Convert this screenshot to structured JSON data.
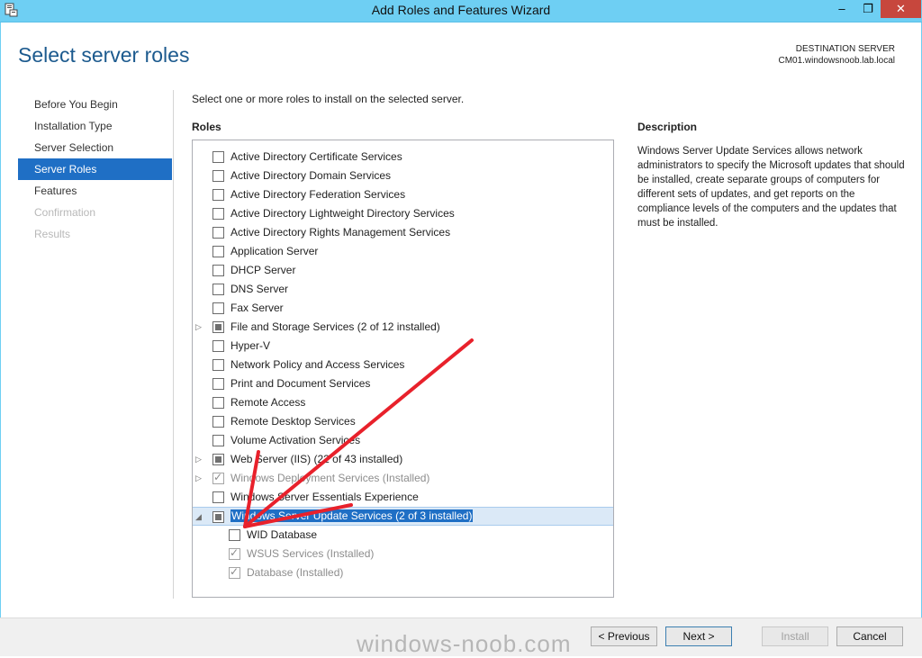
{
  "window": {
    "title": "Add Roles and Features Wizard",
    "min_label": "–",
    "max_label": "❐",
    "close_label": "✕"
  },
  "header": {
    "page_title": "Select server roles",
    "destination_label": "DESTINATION SERVER",
    "destination_value": "CM01.windowsnoob.lab.local"
  },
  "nav": {
    "items": [
      {
        "label": "Before You Begin",
        "state": "normal"
      },
      {
        "label": "Installation Type",
        "state": "normal"
      },
      {
        "label": "Server Selection",
        "state": "normal"
      },
      {
        "label": "Server Roles",
        "state": "active"
      },
      {
        "label": "Features",
        "state": "normal"
      },
      {
        "label": "Confirmation",
        "state": "disabled"
      },
      {
        "label": "Results",
        "state": "disabled"
      }
    ]
  },
  "main": {
    "instruction": "Select one or more roles to install on the selected server.",
    "roles_heading": "Roles",
    "roles": [
      {
        "label": "Active Directory Certificate Services",
        "state": "unchecked",
        "expander": "",
        "indent": 0
      },
      {
        "label": "Active Directory Domain Services",
        "state": "unchecked",
        "expander": "",
        "indent": 0
      },
      {
        "label": "Active Directory Federation Services",
        "state": "unchecked",
        "expander": "",
        "indent": 0
      },
      {
        "label": "Active Directory Lightweight Directory Services",
        "state": "unchecked",
        "expander": "",
        "indent": 0
      },
      {
        "label": "Active Directory Rights Management Services",
        "state": "unchecked",
        "expander": "",
        "indent": 0
      },
      {
        "label": "Application Server",
        "state": "unchecked",
        "expander": "",
        "indent": 0
      },
      {
        "label": "DHCP Server",
        "state": "unchecked",
        "expander": "",
        "indent": 0
      },
      {
        "label": "DNS Server",
        "state": "unchecked",
        "expander": "",
        "indent": 0
      },
      {
        "label": "Fax Server",
        "state": "unchecked",
        "expander": "",
        "indent": 0
      },
      {
        "label": "File and Storage Services (2 of 12 installed)",
        "state": "partial",
        "expander": "collapsed",
        "indent": 0
      },
      {
        "label": "Hyper-V",
        "state": "unchecked",
        "expander": "",
        "indent": 0
      },
      {
        "label": "Network Policy and Access Services",
        "state": "unchecked",
        "expander": "",
        "indent": 0
      },
      {
        "label": "Print and Document Services",
        "state": "unchecked",
        "expander": "",
        "indent": 0
      },
      {
        "label": "Remote Access",
        "state": "unchecked",
        "expander": "",
        "indent": 0
      },
      {
        "label": "Remote Desktop Services",
        "state": "unchecked",
        "expander": "",
        "indent": 0
      },
      {
        "label": "Volume Activation Services",
        "state": "unchecked",
        "expander": "",
        "indent": 0
      },
      {
        "label": "Web Server (IIS) (22 of 43 installed)",
        "state": "partial",
        "expander": "collapsed",
        "indent": 0
      },
      {
        "label": "Windows Deployment Services (Installed)",
        "state": "checked-installed",
        "expander": "collapsed",
        "indent": 0
      },
      {
        "label": "Windows Server Essentials Experience",
        "state": "unchecked",
        "expander": "",
        "indent": 0
      },
      {
        "label": "Windows Server Update Services (2 of 3 installed)",
        "state": "partial",
        "expander": "expanded",
        "indent": 0,
        "selected": true
      },
      {
        "label": "WID Database",
        "state": "unchecked",
        "expander": "",
        "indent": 1
      },
      {
        "label": "WSUS Services (Installed)",
        "state": "checked-installed",
        "expander": "",
        "indent": 1
      },
      {
        "label": "Database (Installed)",
        "state": "checked-installed",
        "expander": "",
        "indent": 1
      }
    ]
  },
  "description": {
    "heading": "Description",
    "text": "Windows Server Update Services allows network administrators to specify the Microsoft updates that should be installed, create separate groups of computers for different sets of updates, and get reports on the compliance levels of the computers and the updates that must be installed."
  },
  "footer": {
    "previous_label": "< Previous",
    "next_label": "Next >",
    "install_label": "Install",
    "cancel_label": "Cancel"
  },
  "watermark": "windows-noob.com",
  "colors": {
    "titlebar": "#6ecff3",
    "accent": "#1f6fc5",
    "page_title": "#1c5a8e",
    "arrow": "#e8212b"
  }
}
